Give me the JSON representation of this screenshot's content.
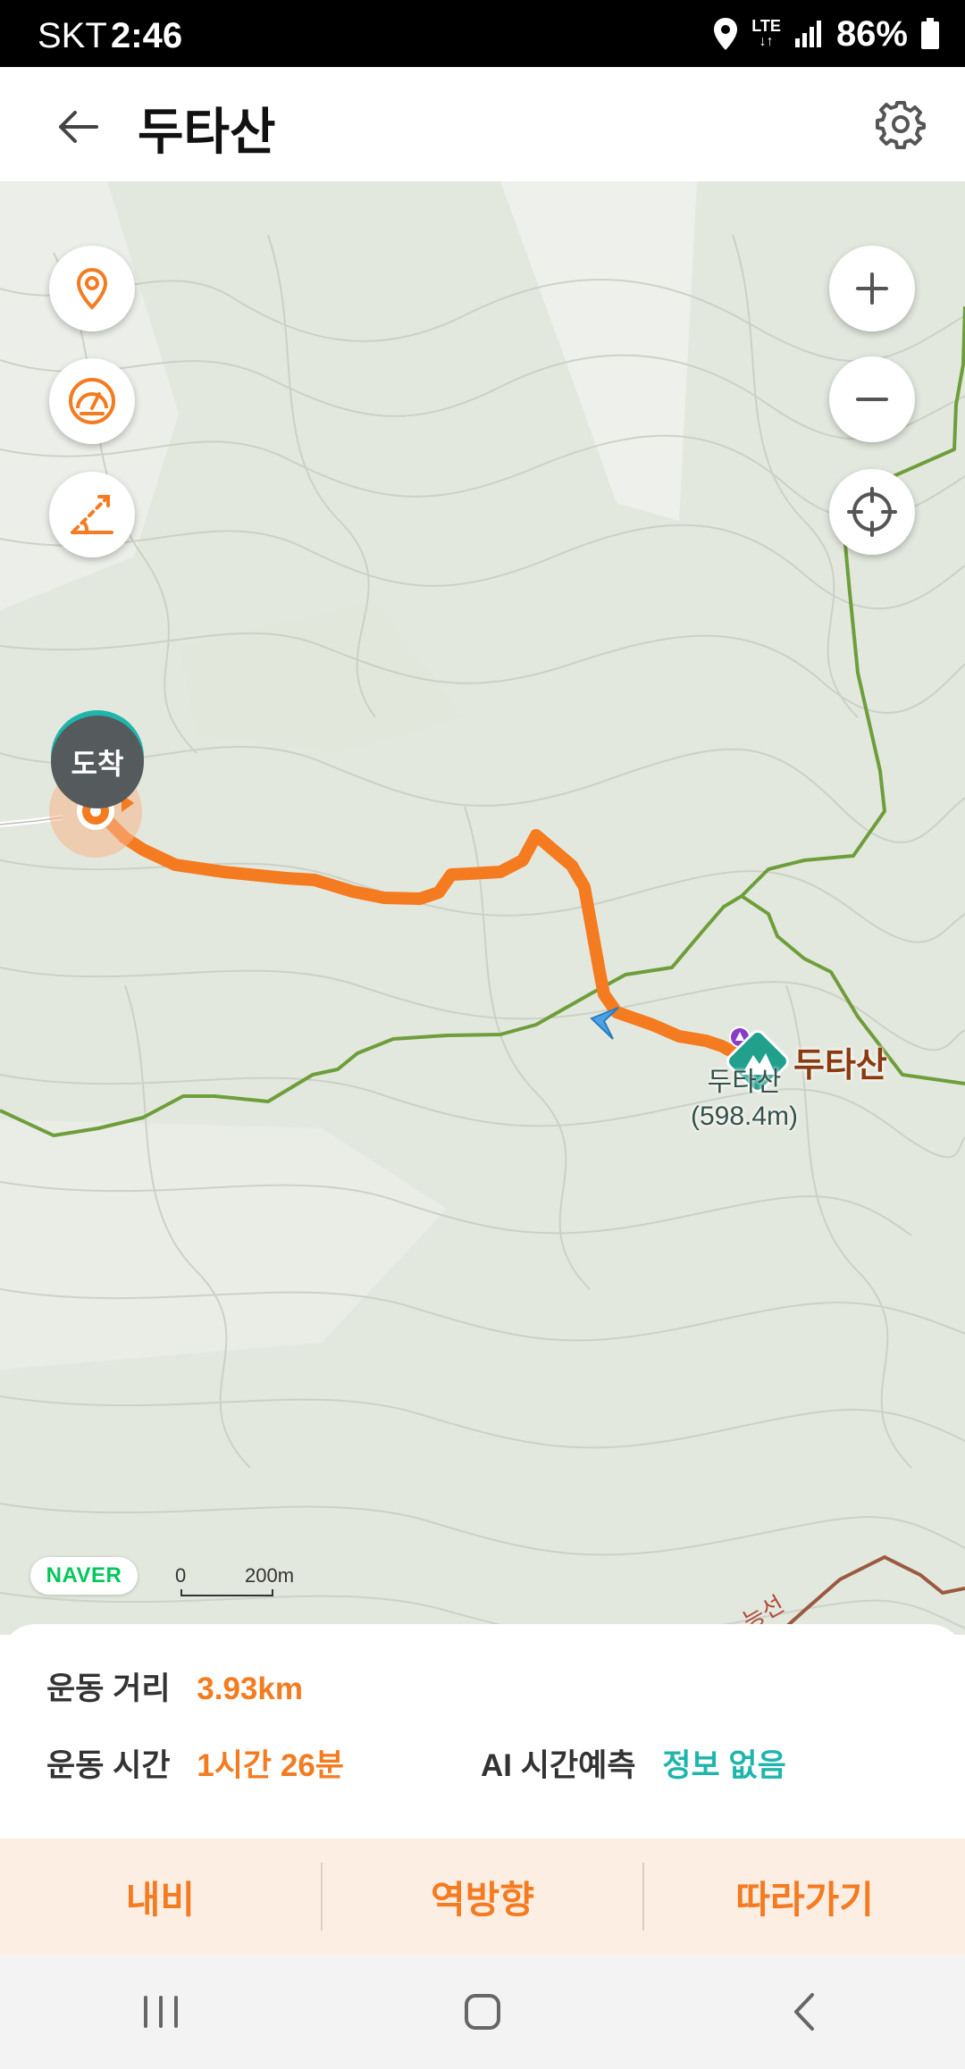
{
  "status_bar": {
    "carrier": "SKT",
    "time": "2:46",
    "network": "LTE",
    "battery": "86%"
  },
  "header": {
    "title": "두타산",
    "back_icon": "back-arrow-icon",
    "settings_icon": "gear-icon"
  },
  "map": {
    "arrival_label": "도착",
    "peak_name": "두타산",
    "peak_sub_name": "두타산",
    "peak_elevation": "(598.4m)",
    "provider": "NAVER",
    "scale_start": "0",
    "scale_end": "200m",
    "left_controls": [
      "location-pin-icon",
      "speedometer-icon",
      "slope-icon"
    ],
    "right_controls": [
      "zoom-in-icon",
      "zoom-out-icon",
      "crosshair-icon"
    ],
    "colors": {
      "route": "#f47b20",
      "trail": "#6e9e3a",
      "accent": "#1fb5ad"
    }
  },
  "info": {
    "distance_label": "운동 거리",
    "distance_value": "3.93km",
    "time_label": "운동 시간",
    "time_value": "1시간 26분",
    "ai_label": "AI 시간예측",
    "ai_value": "정보 없음"
  },
  "actions": {
    "nav": "내비",
    "reverse": "역방향",
    "follow": "따라가기"
  },
  "system_nav": [
    "recent-apps-icon",
    "home-icon",
    "back-icon"
  ]
}
